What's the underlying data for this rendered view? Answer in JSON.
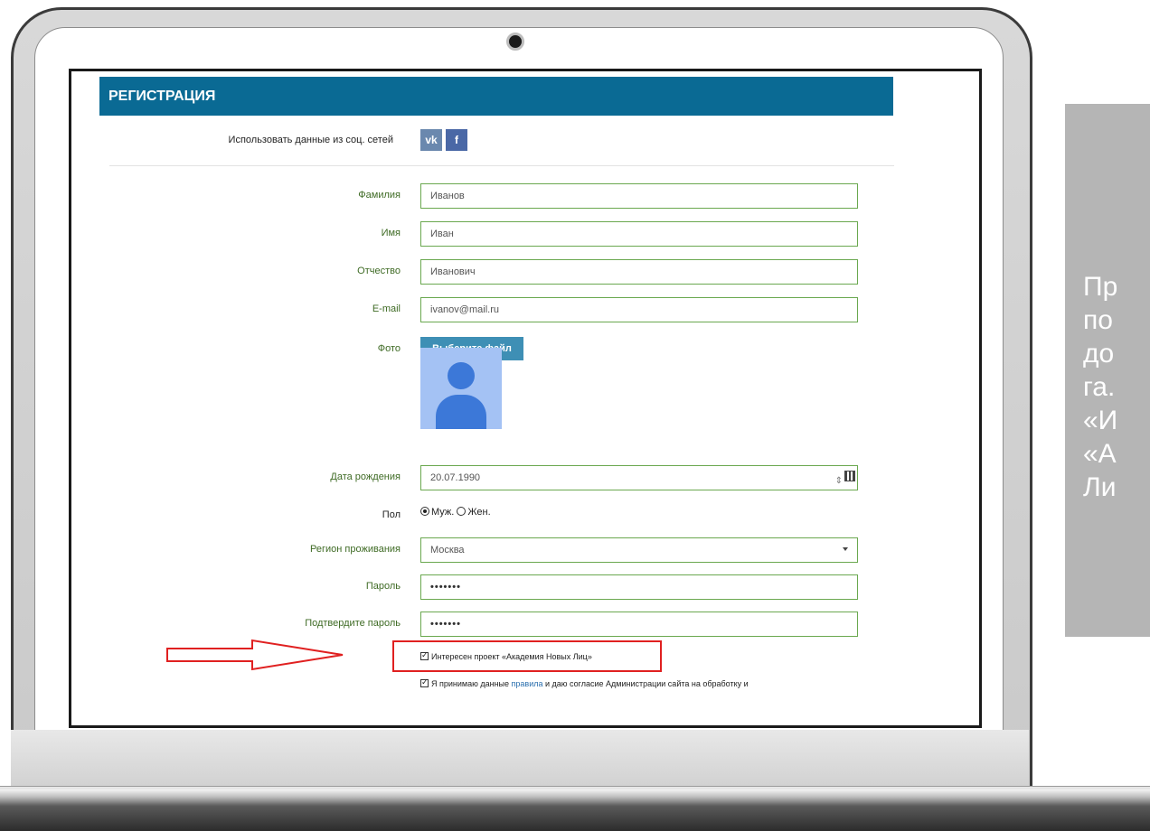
{
  "form": {
    "title": "РЕГИСТРАЦИЯ",
    "social_label": "Использовать данные из соц. сетей",
    "social_vk": "vk",
    "social_fb": "f",
    "fields": {
      "last_name": {
        "label": "Фамилия",
        "value": "Иванов"
      },
      "first_name": {
        "label": "Имя",
        "value": "Иван"
      },
      "patronymic": {
        "label": "Отчество",
        "value": "Иванович"
      },
      "email": {
        "label": "E-mail",
        "value": "ivanov@mail.ru"
      },
      "photo": {
        "label": "Фото",
        "button": "Выберите файл"
      },
      "birth_date": {
        "label": "Дата рождения",
        "value": "20.07.1990"
      },
      "gender": {
        "label": "Пол",
        "male": "Муж.",
        "female": "Жен.",
        "selected": "Муж."
      },
      "region": {
        "label": "Регион проживания",
        "value": "Москва"
      },
      "password": {
        "label": "Пароль",
        "value": "•••••••"
      },
      "password_confirm": {
        "label": "Подтвердите пароль",
        "value": "•••••••"
      }
    },
    "checkboxes": {
      "project_interest": {
        "text": "Интересен проект «Академия Новых Лиц»",
        "checked": true
      },
      "terms_prefix": "Я принимаю данные ",
      "terms_link": "правила",
      "terms_suffix": " и даю согласие Администрации сайта на обработку и",
      "terms_checked": true
    }
  },
  "side_panel": {
    "text": "Пр\nпо\nдо\nга.\n«И\n«А\nЛи"
  },
  "colors": {
    "header_bg": "#0a6a94",
    "label": "#3f6b25",
    "input_border": "#6aa84f",
    "highlight": "#e02020",
    "side_panel_bg": "#b5b5b5"
  }
}
